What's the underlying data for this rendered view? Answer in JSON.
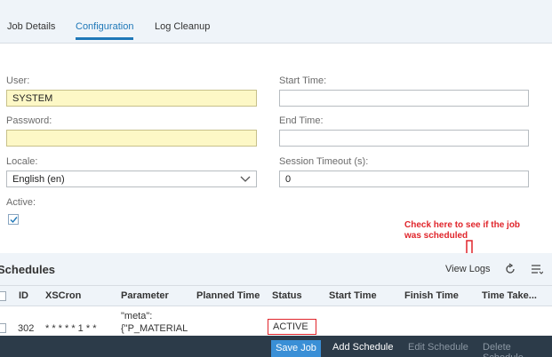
{
  "tabs": [
    {
      "label": "Job Details"
    },
    {
      "label": "Configuration"
    },
    {
      "label": "Log Cleanup"
    }
  ],
  "form": {
    "user_label": "User:",
    "user_value": "SYSTEM",
    "password_label": "Password:",
    "password_value": "",
    "locale_label": "Locale:",
    "locale_value": "English (en)",
    "active_label": "Active:",
    "start_time_label": "Start Time:",
    "start_time_value": "",
    "end_time_label": "End Time:",
    "end_time_value": "",
    "session_timeout_label": "Session Timeout (s):",
    "session_timeout_value": "0"
  },
  "annotation": {
    "line1": "Check here to see if the job",
    "line2": "was scheduled",
    "color": "#e0252b"
  },
  "schedules": {
    "title": "Schedules",
    "view_logs": "View Logs",
    "columns": [
      "ID",
      "XSCron",
      "Parameter",
      "Planned Time",
      "Status",
      "Start Time",
      "Finish Time",
      "Time Take..."
    ],
    "rows": [
      {
        "id": "302",
        "xscron": "* * * * * 1 * *",
        "parameter_line1": "\"meta\":",
        "parameter_line2": "{\"P_MATERIAL",
        "status": "ACTIVE"
      }
    ]
  },
  "footer": {
    "save_job": "Save Job",
    "add_schedule": "Add Schedule",
    "edit_schedule": "Edit Schedule",
    "delete_schedule": "Delete Schedule"
  },
  "colors": {
    "accent": "#1f78b8",
    "field_highlight": "#fdf8c6",
    "footer_bg": "#2c3b49"
  }
}
